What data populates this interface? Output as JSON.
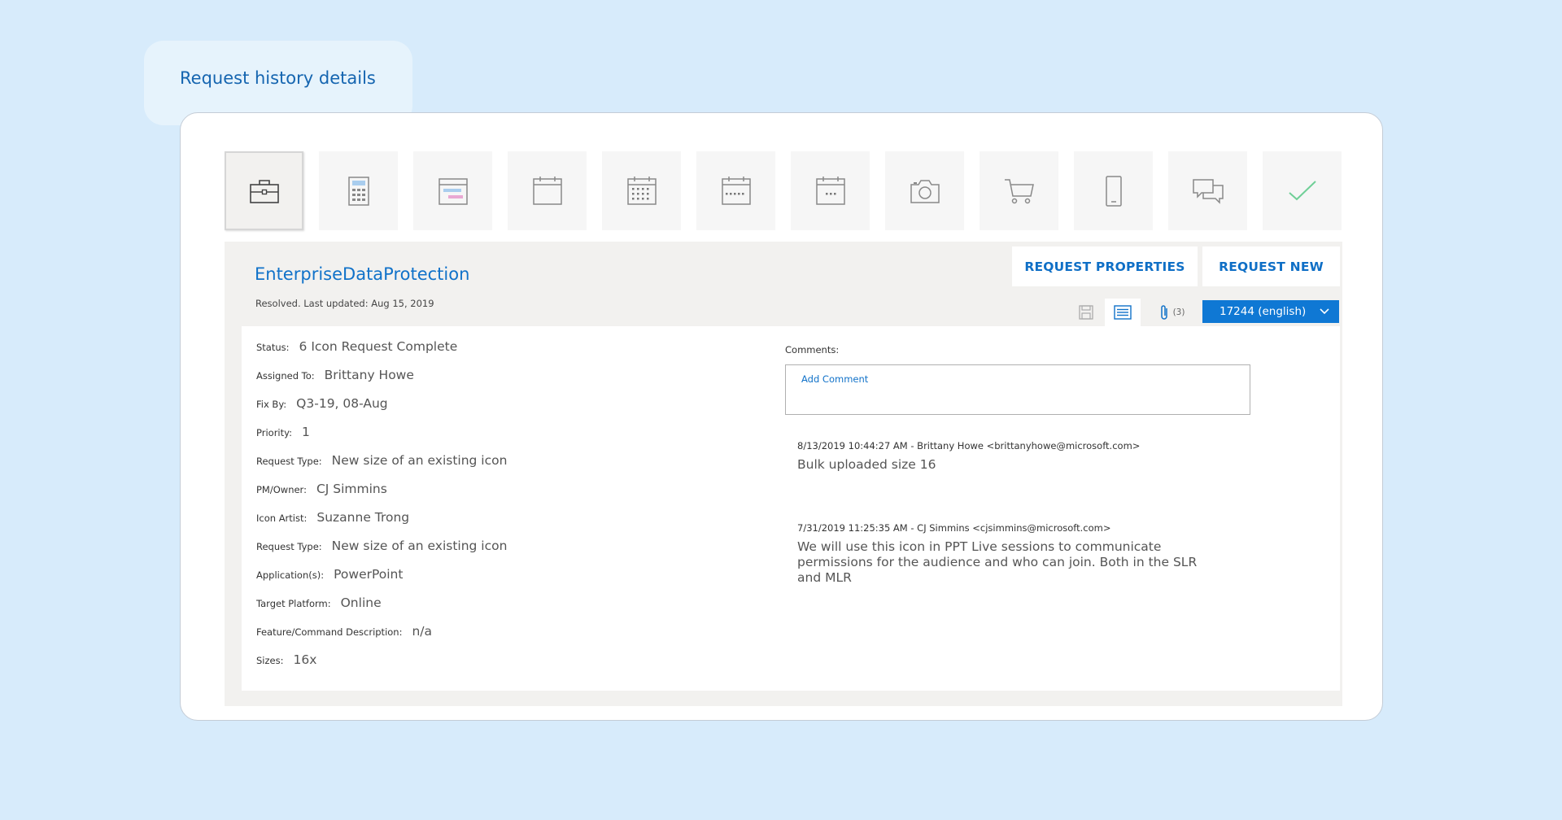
{
  "header": {
    "title": "Request history details"
  },
  "icon_tiles": [
    {
      "icon": "briefcase-icon",
      "selected": true
    },
    {
      "icon": "calculator-icon",
      "selected": false
    },
    {
      "icon": "calendar-agenda-icon",
      "selected": false
    },
    {
      "icon": "calendar-blank-icon",
      "selected": false
    },
    {
      "icon": "calendar-month-icon",
      "selected": false
    },
    {
      "icon": "calendar-week-icon",
      "selected": false
    },
    {
      "icon": "calendar-day-icon",
      "selected": false
    },
    {
      "icon": "camera-icon",
      "selected": false
    },
    {
      "icon": "shopping-cart-icon",
      "selected": false
    },
    {
      "icon": "mobile-phone-icon",
      "selected": false
    },
    {
      "icon": "chat-bubbles-icon",
      "selected": false
    },
    {
      "icon": "checkmark-icon",
      "selected": false
    }
  ],
  "request": {
    "title": "EnterpriseDataProtection",
    "subtitle": "Resolved.  Last updated: Aug 15, 2019"
  },
  "actions": {
    "properties_label": "REQUEST PROPERTIES",
    "new_label": "REQUEST NEW"
  },
  "toolbar": {
    "attachment_count": "(3)",
    "language_select": "17244 (english)"
  },
  "fields": [
    {
      "label": "Status:",
      "value": "6 Icon Request Complete"
    },
    {
      "label": "Assigned To:",
      "value": "Brittany Howe"
    },
    {
      "label": "Fix By:",
      "value": "Q3-19, 08-Aug"
    },
    {
      "label": "Priority:",
      "value": "1"
    },
    {
      "label": "Request Type:",
      "value": "New size of an existing icon"
    },
    {
      "label": "PM/Owner:",
      "value": "CJ Simmins"
    },
    {
      "label": "Icon Artist:",
      "value": "Suzanne Trong"
    },
    {
      "label": "Request Type:",
      "value": "New size of an existing icon"
    },
    {
      "label": "Application(s):",
      "value": "PowerPoint"
    },
    {
      "label": "Target Platform:",
      "value": "Online"
    },
    {
      "label": "Feature/Command Description:",
      "value": "n/a"
    },
    {
      "label": "Sizes:",
      "value": "16x"
    }
  ],
  "comments": {
    "label": "Comments:",
    "add_placeholder": "Add Comment",
    "entries": [
      {
        "meta": "8/13/2019 10:44:27 AM - Brittany Howe <brittanyhowe@microsoft.com>",
        "text": "Bulk uploaded size 16"
      },
      {
        "meta": "7/31/2019 11:25:35 AM - CJ Simmins <cjsimmins@microsoft.com>",
        "text": "We will use this icon in PPT Live sessions to communicate permissions for the audience and who can join. Both in the SLR and MLR"
      }
    ]
  },
  "colors": {
    "background": "#d7ebfb",
    "accent": "#1172c9",
    "select_bg": "#0f78d4",
    "check_green": "#6fcf97"
  }
}
